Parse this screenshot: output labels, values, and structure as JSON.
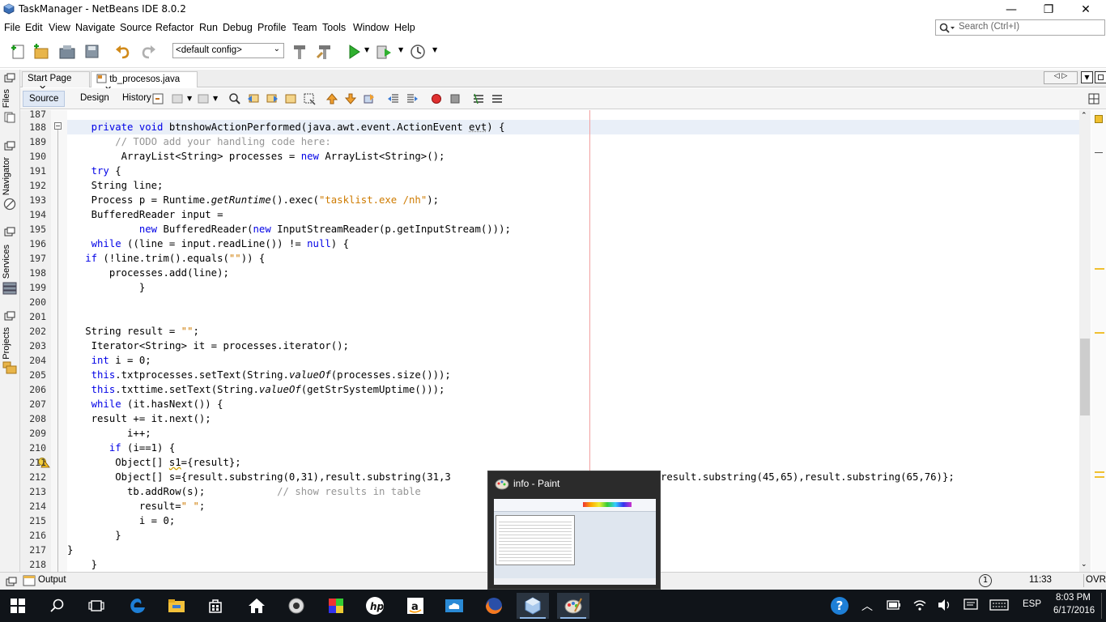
{
  "window": {
    "title": "TaskManager - NetBeans IDE 8.0.2",
    "min": "—",
    "max": "❐",
    "close": "✕"
  },
  "menu": [
    "File",
    "Edit",
    "View",
    "Navigate",
    "Source",
    "Refactor",
    "Run",
    "Debug",
    "Profile",
    "Team",
    "Tools",
    "Window",
    "Help"
  ],
  "search": {
    "placeholder": "Search (Ctrl+I)"
  },
  "toolbar": {
    "config": "<default config>"
  },
  "sidebar": {
    "files": "Files",
    "navigator": "Navigator",
    "services": "Services",
    "projects": "Projects"
  },
  "tabs": [
    {
      "label": "Start Page",
      "close": "✕"
    },
    {
      "label": "tb_procesos.java",
      "close": "✕"
    }
  ],
  "editor_tabs": {
    "source": "Source",
    "design": "Design",
    "history": "History"
  },
  "lines": [
    {
      "n": "187"
    },
    {
      "n": "188"
    },
    {
      "n": "189"
    },
    {
      "n": "190"
    },
    {
      "n": "191"
    },
    {
      "n": "192"
    },
    {
      "n": "193"
    },
    {
      "n": "194"
    },
    {
      "n": "195"
    },
    {
      "n": "196"
    },
    {
      "n": "197"
    },
    {
      "n": "198"
    },
    {
      "n": "199"
    },
    {
      "n": "200"
    },
    {
      "n": "201"
    },
    {
      "n": "202"
    },
    {
      "n": "203"
    },
    {
      "n": "204"
    },
    {
      "n": "205"
    },
    {
      "n": "206"
    },
    {
      "n": "207"
    },
    {
      "n": "208"
    },
    {
      "n": "209"
    },
    {
      "n": "210"
    },
    {
      "n": "211"
    },
    {
      "n": "212"
    },
    {
      "n": "213"
    },
    {
      "n": "214"
    },
    {
      "n": "215"
    },
    {
      "n": "216"
    },
    {
      "n": "217"
    },
    {
      "n": "218"
    }
  ],
  "code": {
    "l188a": "    ",
    "l188kw": "private void",
    "l188b": " btnshowActionPerformed(java.awt.event.ActionEvent ",
    "l188c": "evt",
    "l188d": ") {",
    "l189": "        // TODO add your handling code here:",
    "l190a": "         ArrayList<String> processes = ",
    "l190kw": "new",
    "l190b": " ArrayList<String>();",
    "l191kw": "    try",
    "l191b": " {",
    "l192": "    String line;",
    "l193a": "    Process p = Runtime.",
    "l193it": "getRuntime",
    "l193b": "().exec(",
    "l193st": "\"tasklist.exe /nh\"",
    "l193c": ");",
    "l194": "    BufferedReader input =",
    "l195a": "            ",
    "l195kw": "new",
    "l195b": " BufferedReader(",
    "l195kw2": "new",
    "l195c": " InputStreamReader(p.getInputStream()));",
    "l196kw": "    while",
    "l196b": " ((line = input.readLine()) != ",
    "l196kw2": "null",
    "l196c": ") {",
    "l197kw": "   if",
    "l197b": " (!line.trim().equals(",
    "l197st": "\"\"",
    "l197c": ")) {",
    "l198": "       processes.add(line);",
    "l199": "            }",
    "l202a": "   String result = ",
    "l202st": "\"\"",
    "l202b": ";",
    "l203": "    Iterator<String> it = processes.iterator();",
    "l204kw": "    int",
    "l204b": " i = 0;",
    "l205kw": "    this",
    "l205b": ".txtprocesses.setText(String.",
    "l205it": "valueOf",
    "l205c": "(processes.size()));",
    "l206kw": "    this",
    "l206b": ".txttime.setText(String.",
    "l206it": "valueOf",
    "l206c": "(getStrSystemUptime()));",
    "l207kw": "    while",
    "l207b": " (it.hasNext()) {",
    "l208": "    result += it.next();",
    "l209": "          i++;",
    "l210kw": "       if",
    "l210b": " (i==1) {",
    "l211a": "        Object[] ",
    "l211u": "s1",
    "l211b": "={result};",
    "l212a": "        Object[] s={result.substring(0,31),result.substring(31,3",
    "l212b": "result.substring(45,65),result.substring(65,76)};",
    "l213a": "          tb.addRow(s);            ",
    "l213cm": "// show results in table",
    "l214a": "            result=",
    "l214st": "\" \"",
    "l214b": ";",
    "l215": "            i = 0;",
    "l216": "        }",
    "l217": "}",
    "l218": "    }"
  },
  "output": {
    "label": "Output",
    "info_badge": "1",
    "position": "11:33",
    "mode": "OVR"
  },
  "popup": {
    "title": "info - Paint"
  },
  "tray": {
    "lang": "ESP",
    "time": "8:03 PM",
    "date": "6/17/2016",
    "help": "?"
  },
  "colors": {
    "keyword": "#0000e6",
    "comment": "#969696",
    "string": "#ce7b00",
    "taskbar": "#101419"
  }
}
